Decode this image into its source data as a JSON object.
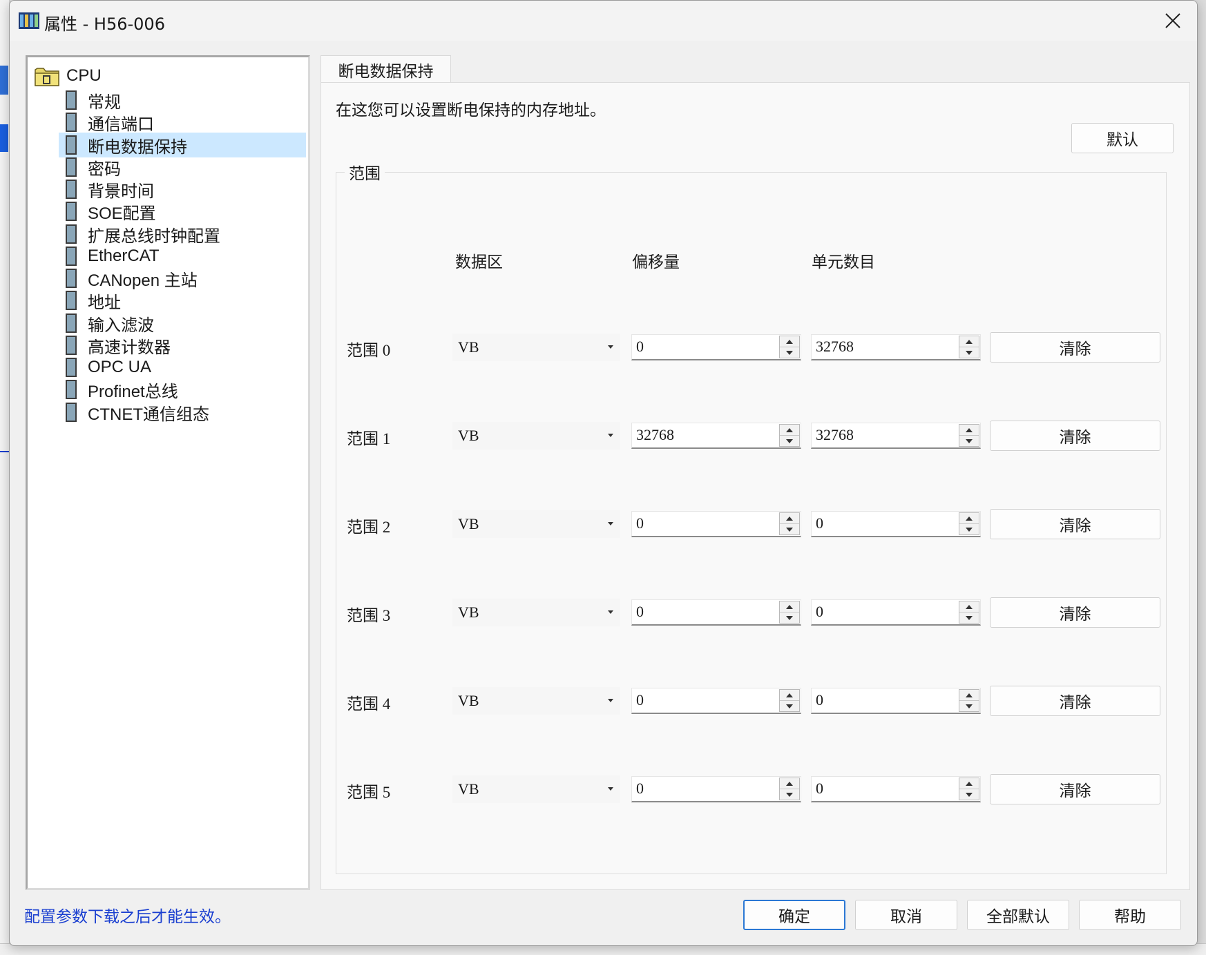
{
  "window": {
    "title": "属性 - H56-006"
  },
  "tree": {
    "root": "CPU",
    "items": [
      {
        "label": "常规",
        "selected": false
      },
      {
        "label": "通信端口",
        "selected": false
      },
      {
        "label": "断电数据保持",
        "selected": true
      },
      {
        "label": "密码",
        "selected": false
      },
      {
        "label": "背景时间",
        "selected": false
      },
      {
        "label": "SOE配置",
        "selected": false
      },
      {
        "label": "扩展总线时钟配置",
        "selected": false
      },
      {
        "label": "EtherCAT",
        "selected": false
      },
      {
        "label": "CANopen 主站",
        "selected": false
      },
      {
        "label": "地址",
        "selected": false
      },
      {
        "label": "输入滤波",
        "selected": false
      },
      {
        "label": "高速计数器",
        "selected": false
      },
      {
        "label": "OPC UA",
        "selected": false
      },
      {
        "label": "Profinet总线",
        "selected": false
      },
      {
        "label": "CTNET通信组态",
        "selected": false
      }
    ]
  },
  "tab": {
    "label": "断电数据保持"
  },
  "panel": {
    "description": "在这您可以设置断电保持的内存地址。",
    "default_button": "默认",
    "group_label": "范围",
    "columns": {
      "data_area": "数据区",
      "offset": "偏移量",
      "count": "单元数目"
    },
    "clear_label": "清除",
    "rows": [
      {
        "label": "范围 0",
        "area": "VB",
        "offset": "0",
        "count": "32768"
      },
      {
        "label": "范围 1",
        "area": "VB",
        "offset": "32768",
        "count": "32768"
      },
      {
        "label": "范围 2",
        "area": "VB",
        "offset": "0",
        "count": "0"
      },
      {
        "label": "范围 3",
        "area": "VB",
        "offset": "0",
        "count": "0"
      },
      {
        "label": "范围 4",
        "area": "VB",
        "offset": "0",
        "count": "0"
      },
      {
        "label": "范围 5",
        "area": "VB",
        "offset": "0",
        "count": "0"
      }
    ]
  },
  "footer": {
    "note": "配置参数下载之后才能生效。",
    "ok": "确定",
    "cancel": "取消",
    "restore_all": "全部默认",
    "help": "帮助"
  },
  "colors": {
    "accent": "#2b78d4",
    "selection": "#cce8ff",
    "note": "#1a3fd0"
  }
}
